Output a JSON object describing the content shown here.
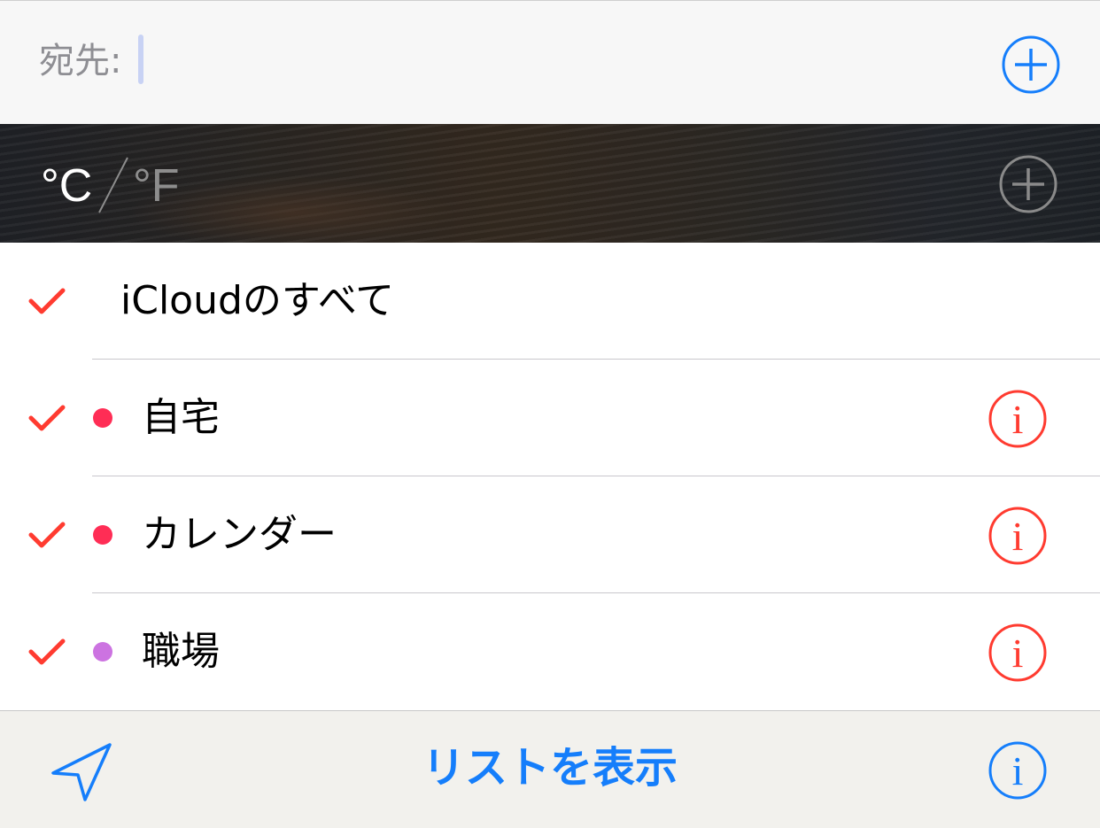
{
  "to_bar": {
    "label": "宛先:",
    "value": "",
    "add_icon": "plus-circle-icon",
    "accent": "#157efb"
  },
  "weather": {
    "unit_c": "°C",
    "unit_f": "°F",
    "selected_unit": "°C",
    "add_icon": "plus-circle-icon"
  },
  "calendars": {
    "all_label": "iCloudのすべて",
    "all_checked": true,
    "items": [
      {
        "label": "自宅",
        "checked": true,
        "color": "#ff2d55",
        "info_icon": "info-circle-icon"
      },
      {
        "label": "カレンダー",
        "checked": true,
        "color": "#ff2d55",
        "info_icon": "info-circle-icon"
      },
      {
        "label": "職場",
        "checked": true,
        "color": "#cc73e1",
        "info_icon": "info-circle-icon"
      }
    ],
    "check_color": "#ff3b30",
    "info_color": "#ff3b30"
  },
  "toolbar": {
    "location_icon": "location-arrow-icon",
    "show_list_label": "リストを表示",
    "info_icon": "info-circle-icon",
    "accent": "#157efb"
  }
}
